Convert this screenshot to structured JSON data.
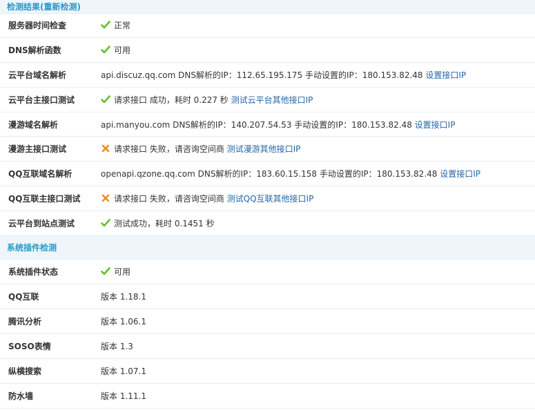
{
  "section1": {
    "title": "检测结果(重新检测)",
    "rows": [
      {
        "label": "服务器时间检查",
        "status": "ok",
        "text": "正常"
      },
      {
        "label": "DNS解析函数",
        "status": "ok",
        "text": "可用"
      },
      {
        "label": "云平台域名解析",
        "status": "none",
        "text": "api.discuz.qq.com DNS解析的IP：112.65.195.175 手动设置的IP：180.153.82.48 ",
        "link": "设置接口IP"
      },
      {
        "label": "云平台主接口测试",
        "status": "ok",
        "text": "请求接口 成功，耗时 0.227 秒 ",
        "link": "测试云平台其他接口IP"
      },
      {
        "label": "漫游域名解析",
        "status": "none",
        "text": "api.manyou.com DNS解析的IP：140.207.54.53 手动设置的IP：180.153.82.48 ",
        "link": "设置接口IP"
      },
      {
        "label": "漫游主接口测试",
        "status": "fail",
        "text": "请求接口 失败，请咨询空间商 ",
        "link": "测试漫游其他接口IP"
      },
      {
        "label": "QQ互联域名解析",
        "status": "none",
        "text": "openapi.qzone.qq.com DNS解析的IP：183.60.15.158 手动设置的IP：180.153.82.48 ",
        "link": "设置接口IP"
      },
      {
        "label": "QQ互联主接口测试",
        "status": "fail",
        "text": "请求接口 失败，请咨询空间商 ",
        "link": "测试QQ互联其他接口IP"
      },
      {
        "label": "云平台到站点测试",
        "status": "ok",
        "text": "测试成功，耗时 0.1451 秒"
      }
    ]
  },
  "section2": {
    "title": "系统插件检测",
    "rows": [
      {
        "label": "系统插件状态",
        "status": "ok",
        "text": "可用"
      },
      {
        "label": "QQ互联",
        "status": "none",
        "text": "版本 1.18.1"
      },
      {
        "label": "腾讯分析",
        "status": "none",
        "text": "版本 1.06.1"
      },
      {
        "label": "SOSO表情",
        "status": "none",
        "text": "版本 1.3"
      },
      {
        "label": "纵横搜索",
        "status": "none",
        "text": "版本 1.07.1"
      },
      {
        "label": "防水墙",
        "status": "none",
        "text": "版本 1.11.1"
      }
    ]
  },
  "colors": {
    "ok": "#5fbf2a",
    "fail": "#f08a1c",
    "link": "#2366a8",
    "header_text": "#2a97c7",
    "header_bg": "#eef6fb"
  }
}
